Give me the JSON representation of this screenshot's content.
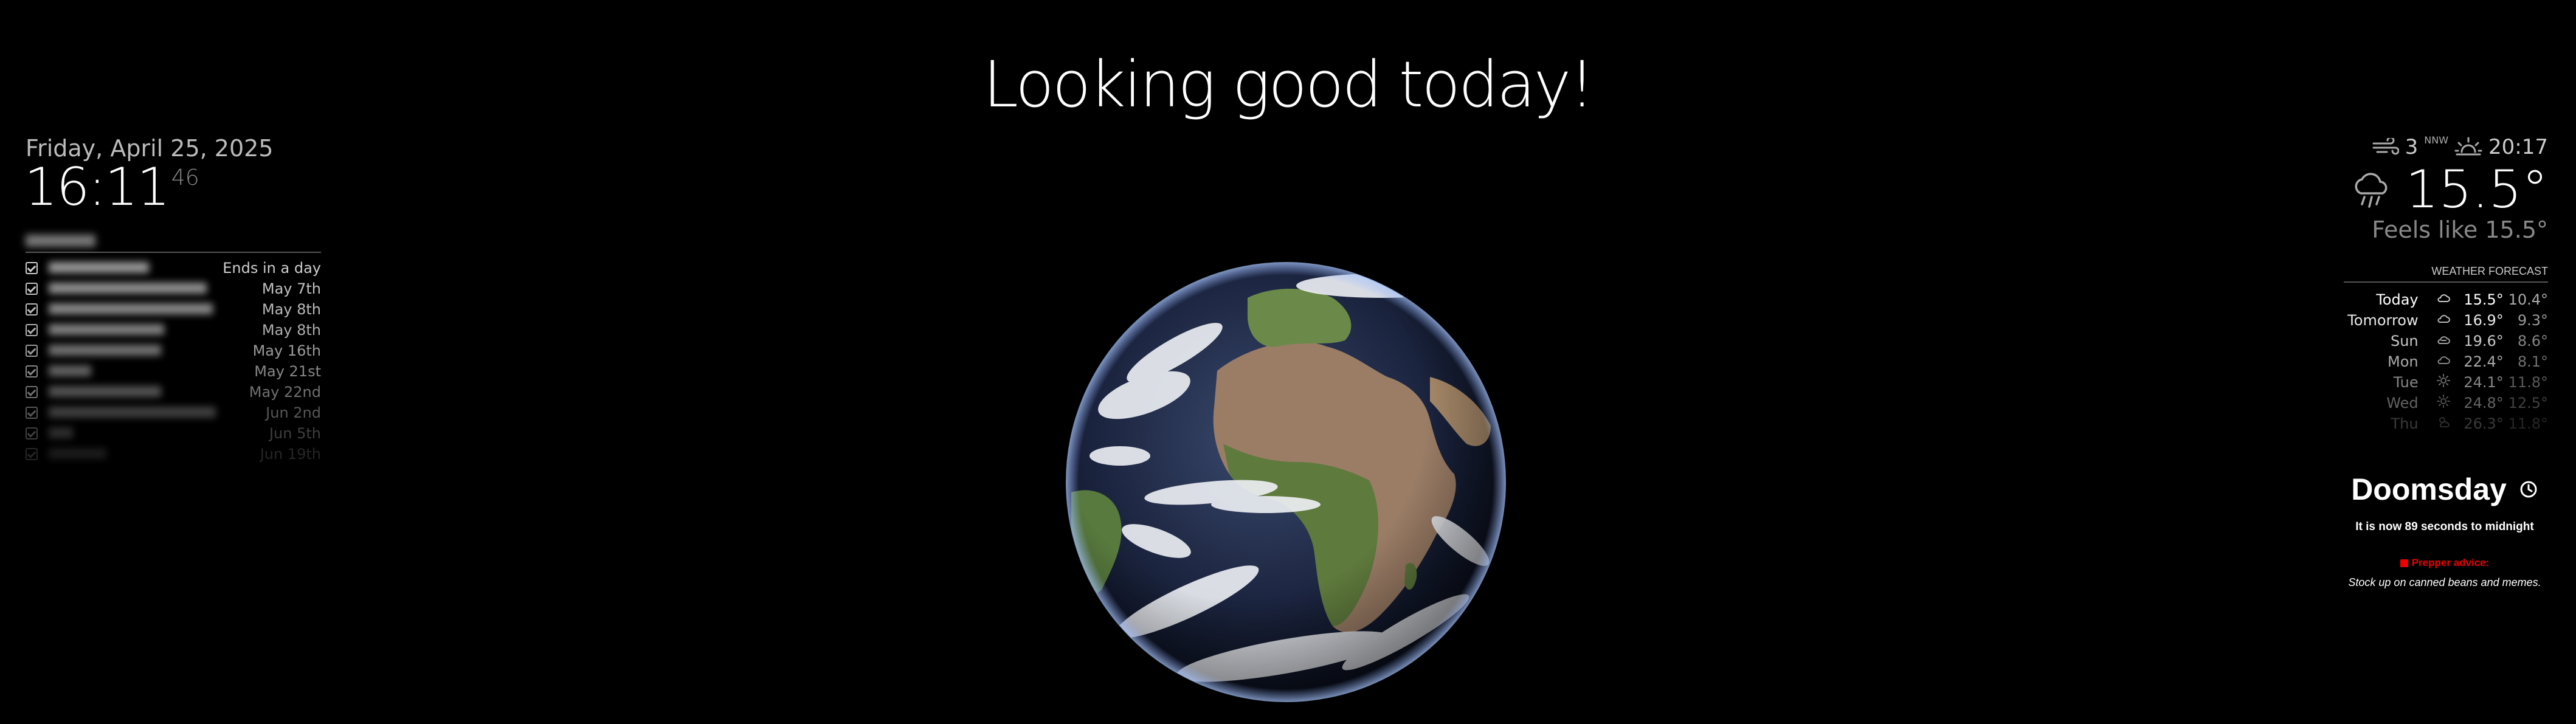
{
  "greeting": "Looking good today!",
  "clock": {
    "date": "Friday, April 25, 2025",
    "time": "16:11",
    "seconds": "46"
  },
  "tasks": {
    "items": [
      {
        "due": "Ends in a day",
        "opacity": 1.0
      },
      {
        "due": "May 7th",
        "opacity": 0.95
      },
      {
        "due": "May 8th",
        "opacity": 0.9
      },
      {
        "due": "May 8th",
        "opacity": 0.85
      },
      {
        "due": "May 16th",
        "opacity": 0.75
      },
      {
        "due": "May 21st",
        "opacity": 0.65
      },
      {
        "due": "May 22nd",
        "opacity": 0.55
      },
      {
        "due": "Jun 2nd",
        "opacity": 0.42
      },
      {
        "due": "Jun 5th",
        "opacity": 0.3
      },
      {
        "due": "Jun 19th",
        "opacity": 0.18
      }
    ]
  },
  "weather": {
    "wind_speed": "3",
    "wind_direction": "NNW",
    "sunset": "20:17",
    "current_temp": "15.5°",
    "feels_like": "Feels like 15.5°",
    "current_icon": "rain-cloud-icon"
  },
  "forecast": {
    "header": "WEATHER FORECAST",
    "days": [
      {
        "day": "Today",
        "max": "15.5°",
        "min": "10.4°",
        "icon": "cloud-icon",
        "opacity": 1.0
      },
      {
        "day": "Tomorrow",
        "max": "16.9°",
        "min": "9.3°",
        "icon": "cloud-icon",
        "opacity": 0.9
      },
      {
        "day": "Sun",
        "max": "19.6°",
        "min": "8.6°",
        "icon": "cloudy-icon",
        "opacity": 0.78
      },
      {
        "day": "Mon",
        "max": "22.4°",
        "min": "8.1°",
        "icon": "cloud-icon",
        "opacity": 0.66
      },
      {
        "day": "Tue",
        "max": "24.1°",
        "min": "11.8°",
        "icon": "sun-icon",
        "opacity": 0.52
      },
      {
        "day": "Wed",
        "max": "24.8°",
        "min": "12.5°",
        "icon": "sun-icon",
        "opacity": 0.38
      },
      {
        "day": "Thu",
        "max": "26.3°",
        "min": "11.8°",
        "icon": "partly-sunny-icon",
        "opacity": 0.22
      }
    ]
  },
  "doomsday": {
    "title": "Doomsday",
    "subtitle": "It is now 89 seconds to midnight",
    "advice_label": "Prepper advice:",
    "advice": "Stock up on canned beans and memes."
  }
}
